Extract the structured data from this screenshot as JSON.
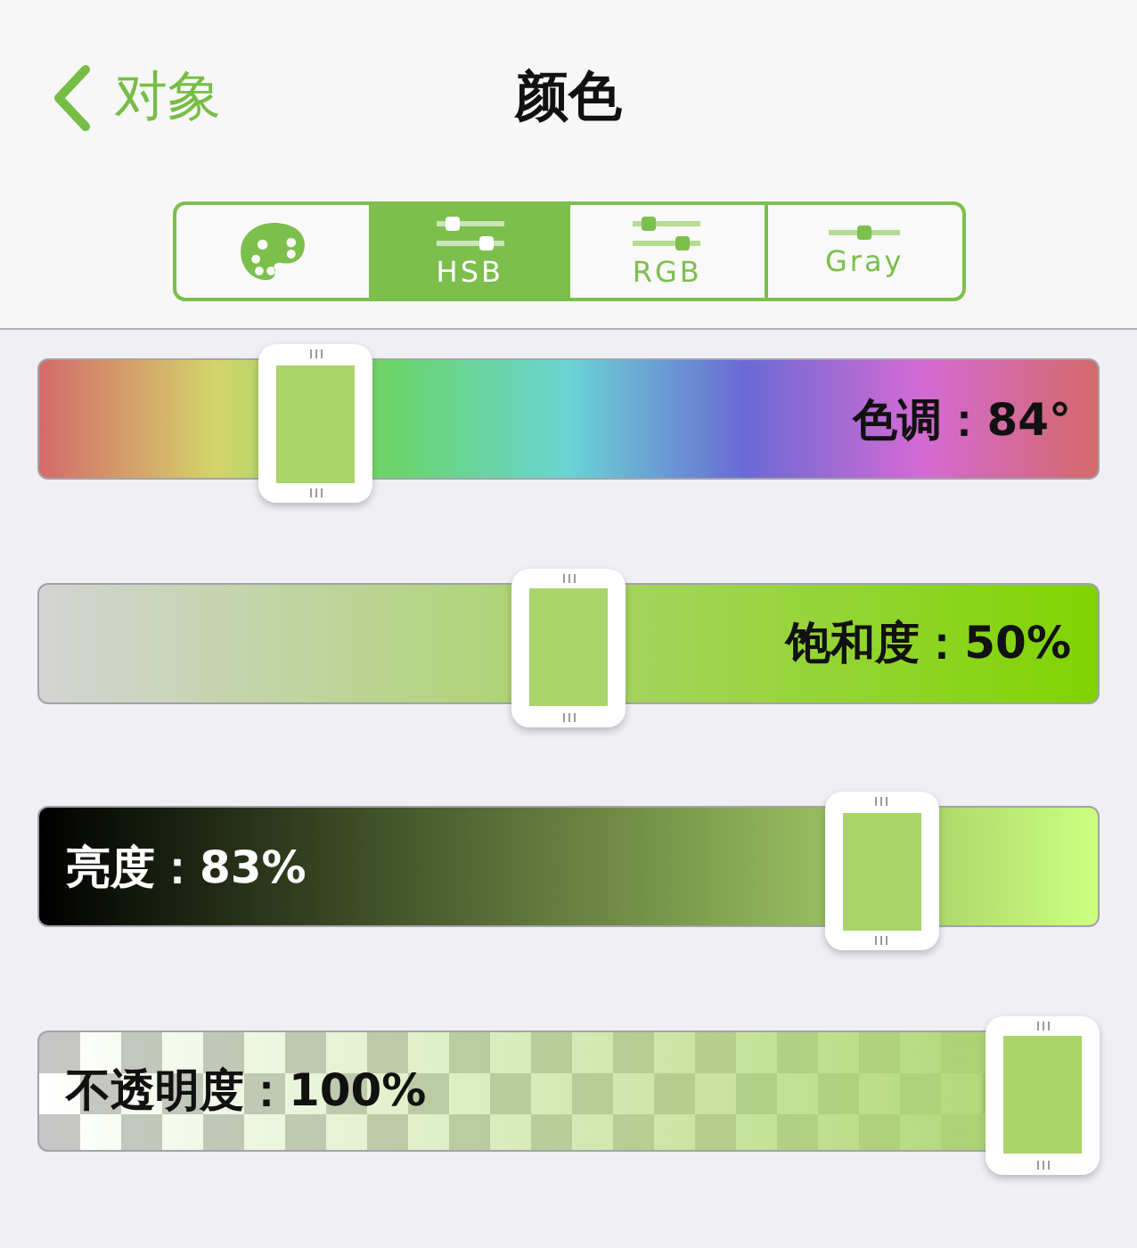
{
  "navigation": {
    "back_label": "对象",
    "title": "颜色"
  },
  "color_modes": [
    {
      "kind": "palette",
      "selected": false
    },
    {
      "kind": "sliders",
      "label": "HSB",
      "selected": true
    },
    {
      "kind": "sliders",
      "label": "RGB",
      "selected": false
    },
    {
      "kind": "slider",
      "label": "Gray",
      "selected": false
    }
  ],
  "channels": [
    {
      "kind": "hue",
      "label": "色调：84°",
      "level": 0.2333
    },
    {
      "kind": "saturation",
      "label": "饱和度：50%",
      "level": 0.5
    },
    {
      "kind": "brightness",
      "label": "亮度：83%",
      "level": 0.83
    },
    {
      "kind": "opacity",
      "label": "不透明度：100%",
      "level": 1
    }
  ]
}
